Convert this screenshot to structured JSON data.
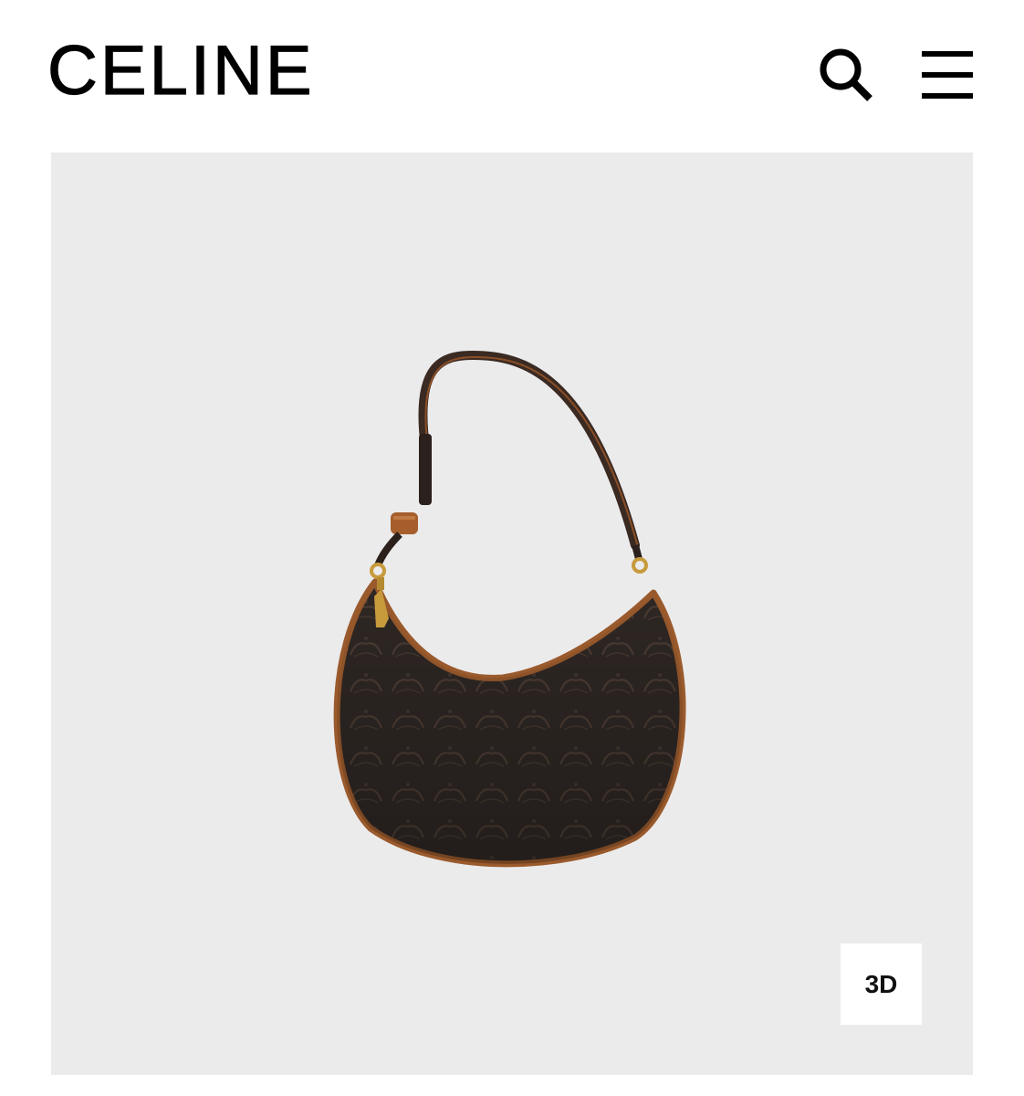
{
  "header": {
    "logo_text": "CELINE",
    "search_icon": "search-icon",
    "menu_icon": "hamburger-menu-icon"
  },
  "product": {
    "image_subject": "handbag",
    "view_3d_label": "3D",
    "colors": {
      "background": "#ebebec",
      "bag_body": "#2e2724",
      "trim": "#9a5a2c",
      "hardware": "#c79a3c"
    }
  }
}
